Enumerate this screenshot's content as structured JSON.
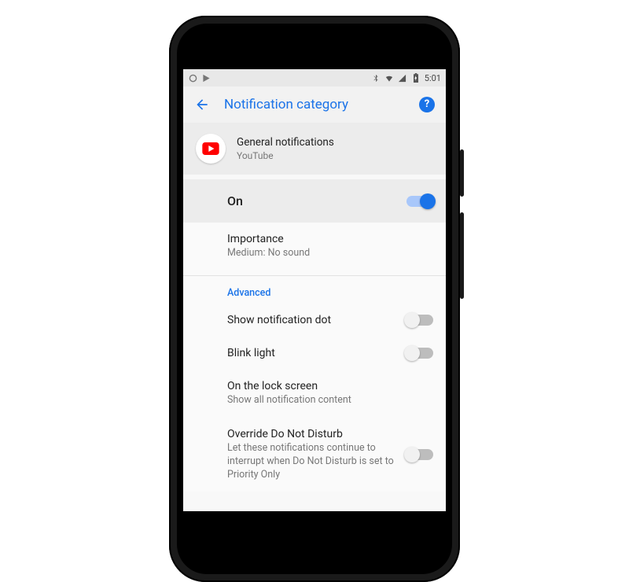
{
  "statusbar": {
    "time": "5:01"
  },
  "appbar": {
    "title": "Notification category"
  },
  "channel": {
    "name": "General notifications",
    "app": "YouTube"
  },
  "master": {
    "label": "On",
    "state": true
  },
  "importance": {
    "title": "Importance",
    "value": "Medium: No sound"
  },
  "advanced": {
    "label": "Advanced",
    "items": [
      {
        "title": "Show notification dot",
        "toggle": false
      },
      {
        "title": "Blink light",
        "toggle": false
      },
      {
        "title": "On the lock screen",
        "subtitle": "Show all notification content"
      },
      {
        "title": "Override Do Not Disturb",
        "subtitle": "Let these notifications continue to interrupt when Do Not Disturb is set to Priority Only",
        "toggle": false
      }
    ]
  }
}
